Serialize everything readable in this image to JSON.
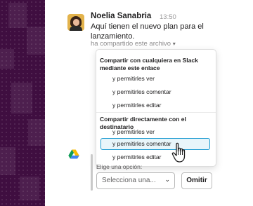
{
  "message": {
    "author": "Noelia Sanabria",
    "time": "13:50",
    "text": "Aquí tienen el nuevo plan para el lanzamiento.",
    "shared_file": "ha compartido este archivo",
    "shared_caret": "▾"
  },
  "dropdown": {
    "section1_title": "Compartir con cualquiera en Slack mediante este enlace",
    "section1_items": [
      "y permitirles ver",
      "y permitirles comentar",
      "y permitirles editar"
    ],
    "section2_title": "Compartir directamente con el destinatario",
    "section2_items": [
      "y permitirles ver",
      "y permitirles comentar",
      "y permitirles editar"
    ]
  },
  "attachment": {
    "prompt": "Elige una opción:",
    "select_placeholder": "Selecciona una...",
    "select_chevron": "⌄",
    "dismiss_label": "Omitir"
  },
  "colors": {
    "sidebar": "#3f0e40",
    "selected_border": "#1d9bd1",
    "selected_bg": "#e8f5fa"
  },
  "icons": {
    "app": "google-drive-icon",
    "pointer": "hand-pointer-icon"
  }
}
